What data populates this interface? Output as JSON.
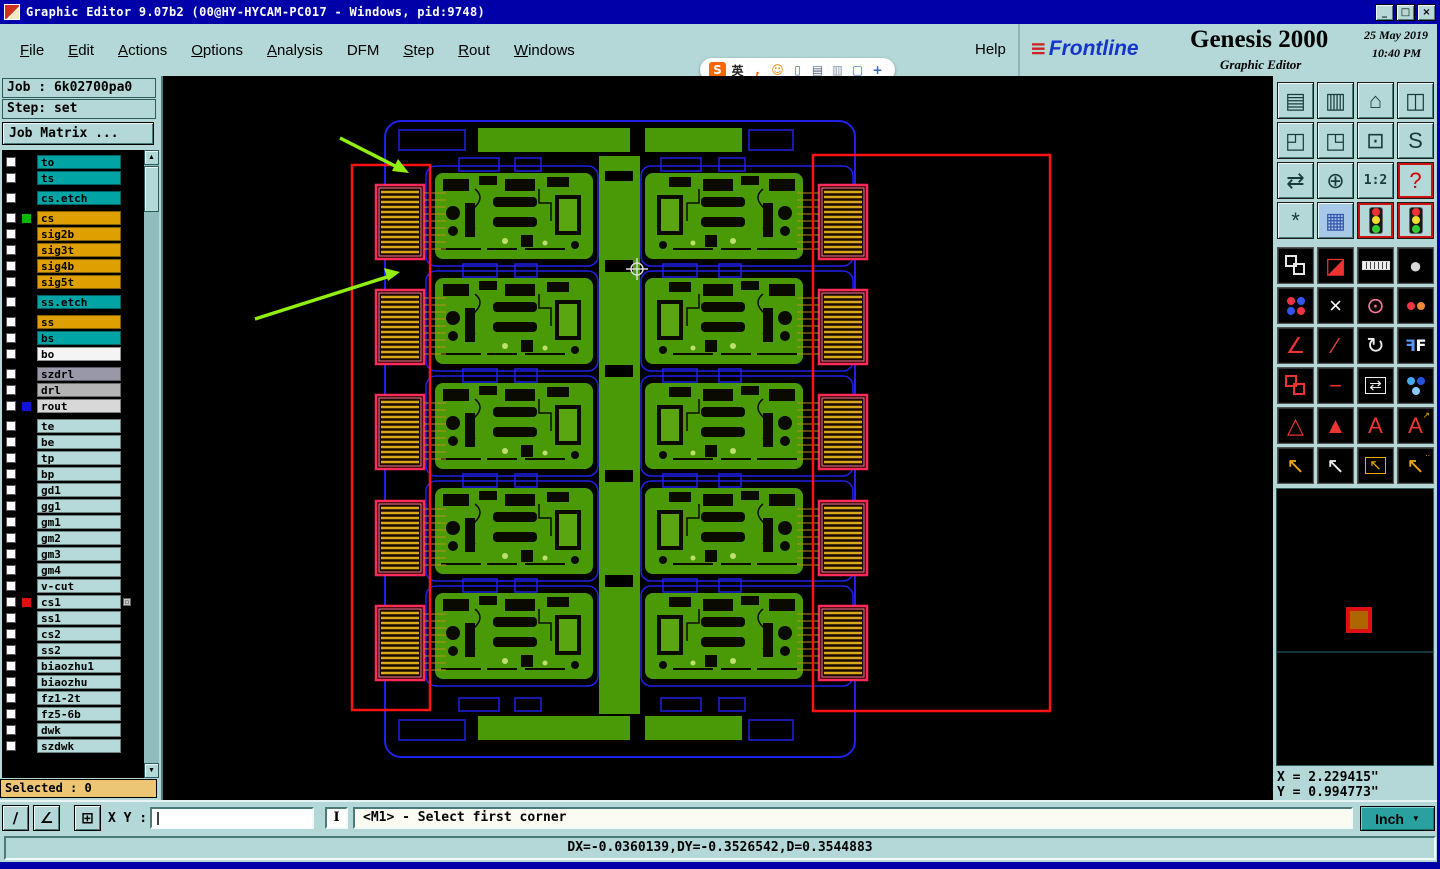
{
  "window": {
    "title": "Graphic Editor 9.07b2 (00@HY-HYCAM-PC017 - Windows, pid:9748)",
    "controls": [
      {
        "name": "minimize-button",
        "glyph": "_"
      },
      {
        "name": "restore-button",
        "glyph": "□"
      },
      {
        "name": "close-button",
        "glyph": "×"
      }
    ]
  },
  "menu": {
    "items": [
      {
        "label": "File",
        "u": 0
      },
      {
        "label": "Edit",
        "u": 0
      },
      {
        "label": "Actions",
        "u": 0
      },
      {
        "label": "Options",
        "u": 0
      },
      {
        "label": "Analysis",
        "u": 0
      },
      {
        "label": "DFM",
        "u": -1
      },
      {
        "label": "Step",
        "u": 0
      },
      {
        "label": "Rout",
        "u": 0
      },
      {
        "label": "Windows",
        "u": 0
      }
    ],
    "help": "Help"
  },
  "ime": {
    "icons": [
      {
        "name": "sogou-icon",
        "glyph": "S",
        "fg": "#ffffff",
        "bg": "#ff6600"
      },
      {
        "name": "lang-english-icon",
        "glyph": "英",
        "fg": "#222222",
        "bg": "#ffffff"
      },
      {
        "name": "comma-icon",
        "glyph": ",",
        "fg": "#ff6600",
        "bg": "#ffffff"
      },
      {
        "name": "smiley-icon",
        "glyph": "☺",
        "fg": "#ee8800",
        "bg": "#ffffff"
      },
      {
        "name": "mic-icon",
        "glyph": "▯",
        "fg": "#5577aa",
        "bg": "#ffffff"
      },
      {
        "name": "keyboard-icon",
        "glyph": "▤",
        "fg": "#556677",
        "bg": "#ffffff"
      },
      {
        "name": "print-icon",
        "glyph": "▥",
        "fg": "#8899aa",
        "bg": "#ffffff"
      },
      {
        "name": "trash-icon",
        "glyph": "▢",
        "fg": "#3366cc",
        "bg": "#ffffff"
      },
      {
        "name": "toolbox-icon",
        "glyph": "+",
        "fg": "#3366cc",
        "bg": "#ffffff"
      }
    ]
  },
  "brand": {
    "logo_mark": "≡",
    "logo_text": "Frontline",
    "product": "Genesis 2000",
    "date": "25 May 2019",
    "time": "10:40 PM",
    "subtitle": "Graphic Editor"
  },
  "job_panel": {
    "job": "Job : 6k02700pa0",
    "step": "Step: set",
    "matrix_button": "Job Matrix ..."
  },
  "layers": {
    "scroll_up": "▲",
    "scroll_down": "▼",
    "selected": "Selected : 0",
    "groups": [
      [
        {
          "name": "to",
          "bg": "#00a4a4"
        },
        {
          "name": "ts",
          "bg": "#00a4a4"
        }
      ],
      [
        {
          "name": "cs.etch",
          "bg": "#00a4a4"
        }
      ],
      [
        {
          "name": "cs",
          "bg": "#df9f00",
          "ind": "#00bb00"
        },
        {
          "name": "sig2b",
          "bg": "#df9f00"
        },
        {
          "name": "sig3t",
          "bg": "#df9f00"
        },
        {
          "name": "sig4b",
          "bg": "#df9f00"
        },
        {
          "name": "sig5t",
          "bg": "#df9f00"
        }
      ],
      [
        {
          "name": "ss.etch",
          "bg": "#00a4a4"
        }
      ],
      [
        {
          "name": "ss",
          "bg": "#df9f00"
        },
        {
          "name": "bs",
          "bg": "#00a4a4"
        },
        {
          "name": "bo",
          "bg": "#f4f4f4"
        }
      ],
      [
        {
          "name": "szdrl",
          "bg": "#9898a8"
        },
        {
          "name": "drl",
          "bg": "#b4b4b4"
        },
        {
          "name": "rout",
          "bg": "#d8d8d8",
          "ind": "#1111dd"
        }
      ],
      [
        {
          "name": "te",
          "bg": "#b6dada"
        },
        {
          "name": "be",
          "bg": "#b6dada"
        },
        {
          "name": "tp",
          "bg": "#b6dada"
        },
        {
          "name": "bp",
          "bg": "#b6dada"
        },
        {
          "name": "gd1",
          "bg": "#b6dada"
        },
        {
          "name": "gg1",
          "bg": "#b6dada"
        },
        {
          "name": "gm1",
          "bg": "#b6dada"
        },
        {
          "name": "gm2",
          "bg": "#b6dada"
        },
        {
          "name": "gm3",
          "bg": "#b6dada"
        },
        {
          "name": "gm4",
          "bg": "#b6dada"
        },
        {
          "name": "v-cut",
          "bg": "#b6dada"
        },
        {
          "name": "cs1",
          "bg": "#b6dada",
          "ind": "#dd1111",
          "badge": "▫"
        },
        {
          "name": "ss1",
          "bg": "#b6dada"
        },
        {
          "name": "cs2",
          "bg": "#b6dada"
        },
        {
          "name": "ss2",
          "bg": "#b6dada"
        },
        {
          "name": "biaozhu1",
          "bg": "#b6dada"
        },
        {
          "name": "biaozhu",
          "bg": "#b6dada"
        },
        {
          "name": "fz1-2t",
          "bg": "#b6dada"
        },
        {
          "name": "fz5-6b",
          "bg": "#b6dada"
        },
        {
          "name": "dwk",
          "bg": "#b6dada"
        },
        {
          "name": "szdwk",
          "bg": "#b6dada"
        }
      ]
    ]
  },
  "toolbar": {
    "buttons": [
      {
        "name": "save-screen-button",
        "g": "▤"
      },
      {
        "name": "monitor-button",
        "g": "▥"
      },
      {
        "name": "home-view-button",
        "g": "⌂"
      },
      {
        "name": "tile-windows-button",
        "g": "◫"
      },
      {
        "name": "zoom-prev-button",
        "g": "◰"
      },
      {
        "name": "zoom-next-button",
        "g": "◳"
      },
      {
        "name": "zoom-fit-button",
        "g": "⊡"
      },
      {
        "name": "s-curve-button",
        "g": "S"
      },
      {
        "name": "pan-arrows-button",
        "g": "⇄"
      },
      {
        "name": "center-view-button",
        "g": "⊕"
      },
      {
        "name": "scale-1-2-button",
        "g": "1:2",
        "small": true
      },
      {
        "name": "help-mode-button",
        "g": "?",
        "fg": "#cc0000",
        "active": true
      },
      {
        "name": "utilities-button",
        "g": "*"
      },
      {
        "name": "grid-toggle-button",
        "g": "▦",
        "bg": "#a8c8e8",
        "fg": "#3355aa"
      },
      {
        "name": "layer-lights-button",
        "t": "traffic",
        "active": true
      },
      {
        "name": "layer-lights-alt-button",
        "t": "traffic",
        "active": true
      },
      {
        "name": "copy-layer-button",
        "t": "sq2",
        "c": "#e8e8e8"
      },
      {
        "name": "corner-shape-button",
        "g": "◪",
        "fg": "#ee3333"
      },
      {
        "name": "ruler-button",
        "t": "ruler"
      },
      {
        "name": "filled-circle-button",
        "g": "●",
        "fg": "#d8d8d8"
      },
      {
        "name": "pads-button",
        "t": "dots",
        "cols": [
          "#ee3344",
          "#3355ee",
          "#3355ee",
          "#ee3344"
        ]
      },
      {
        "name": "delete-button",
        "g": "×",
        "fg": "#ffffff"
      },
      {
        "name": "circle-select-button",
        "g": "⊙",
        "fg": "#ff7799"
      },
      {
        "name": "two-pads-button",
        "t": "dots",
        "cols": [
          "#ee3344",
          "#ee8833"
        ]
      },
      {
        "name": "angle-line-button",
        "g": "∠",
        "fg": "#ee3333"
      },
      {
        "name": "slant-line-button",
        "g": "∕",
        "fg": "#ee4444"
      },
      {
        "name": "rotate-button",
        "g": "↻",
        "fg": "#eeeeee"
      },
      {
        "name": "mirror-f-button",
        "t": "flipF"
      },
      {
        "name": "nested-squares-button",
        "t": "sq2",
        "c": "#ee3333"
      },
      {
        "name": "red-dash-button",
        "g": "−",
        "fg": "#ee3333"
      },
      {
        "name": "transform-box-button",
        "g": "⇄",
        "fg": "#eeeeee",
        "box": true
      },
      {
        "name": "blue-balls-button",
        "t": "dots",
        "cols": [
          "#44aaee",
          "#2255dd",
          "#88ccff"
        ]
      },
      {
        "name": "triangle-outline-button",
        "g": "△",
        "fg": "#ee3333"
      },
      {
        "name": "triangle-fill-button",
        "g": "▲",
        "fg": "#ee3333"
      },
      {
        "name": "letter-a-button",
        "g": "A",
        "fg": "#ee3333"
      },
      {
        "name": "letter-a-arrow-button",
        "g": "A",
        "fg": "#ee3333",
        "arrow": "↗"
      },
      {
        "name": "select-cursor-button",
        "g": "↖",
        "fg": "#eeaa00"
      },
      {
        "name": "select-cursor-alt-button",
        "g": "↖",
        "fg": "#eeeeee"
      },
      {
        "name": "select-box-cursor-button",
        "g": "↖",
        "fg": "#eeaa00",
        "box": true
      },
      {
        "name": "select-multi-cursor-button",
        "g": "↖",
        "fg": "#eeaa00",
        "arrow": "∙∙"
      }
    ]
  },
  "coords": {
    "x": "X = 2.229415\"",
    "y": "Y = 0.994773\""
  },
  "bottom": {
    "tools": [
      {
        "name": "draw-line-button",
        "glyph": "∕"
      },
      {
        "name": "measure-angle-button",
        "glyph": "∠"
      },
      {
        "name": "grid-snap-button",
        "glyph": "⊞",
        "gap": true
      }
    ],
    "xy_label": "X Y :",
    "xy_value": "",
    "cursor_label": "I",
    "status": "<M1> - Select first corner",
    "units": "Inch",
    "units_arrow": "▼"
  },
  "statusbar": {
    "text": "DX=-0.0360139,DY=-0.3526542,D=0.3544883"
  }
}
